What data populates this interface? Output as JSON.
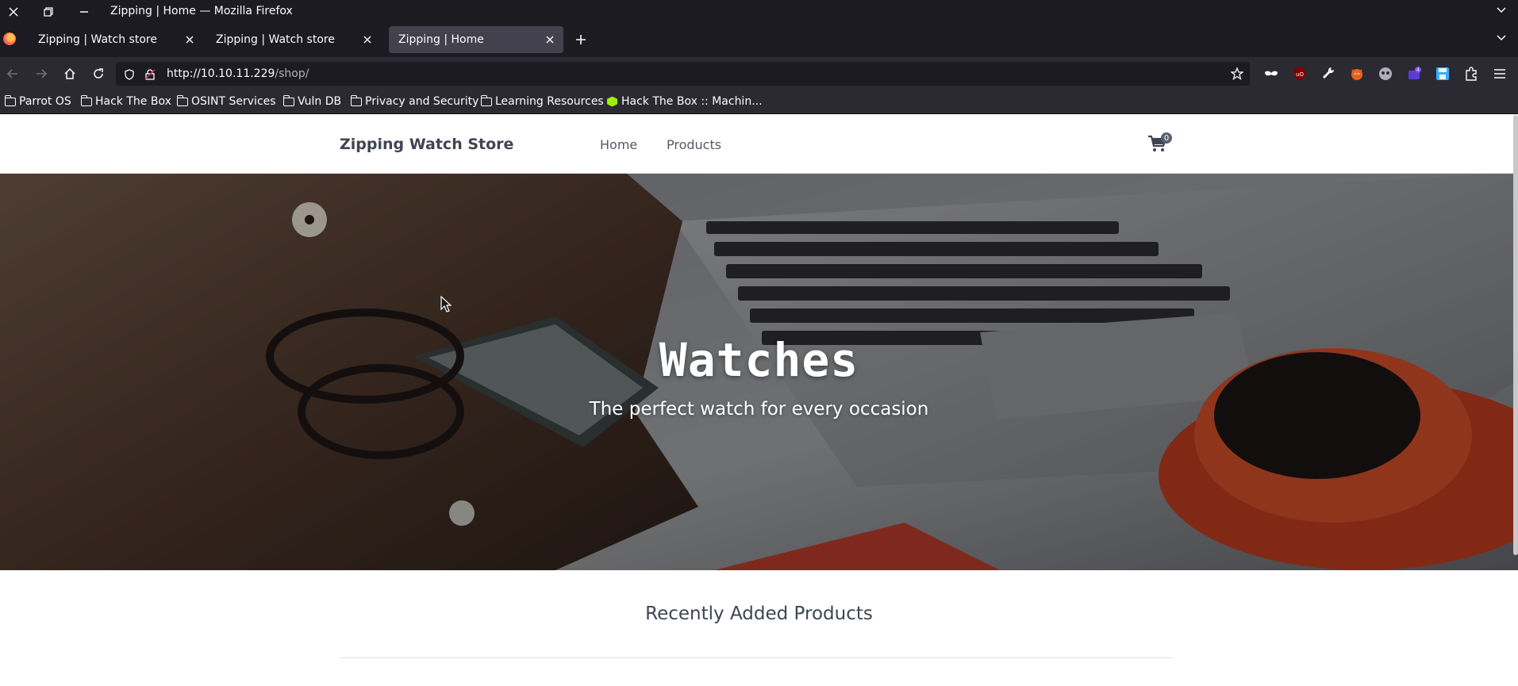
{
  "window": {
    "title": "Zipping | Home — Mozilla Firefox"
  },
  "tabs": [
    {
      "label": "Zipping | Watch store",
      "active": false
    },
    {
      "label": "Zipping | Watch store",
      "active": false
    },
    {
      "label": "Zipping | Home",
      "active": true
    }
  ],
  "navigation": {
    "url_host": "http://10.10.11.229",
    "url_path": "/shop/"
  },
  "bookmarks": [
    {
      "label": "Parrot OS",
      "icon": "folder-icon"
    },
    {
      "label": "Hack The Box",
      "icon": "folder-icon"
    },
    {
      "label": "OSINT Services",
      "icon": "folder-icon"
    },
    {
      "label": "Vuln DB",
      "icon": "folder-icon"
    },
    {
      "label": "Privacy and Security",
      "icon": "folder-icon"
    },
    {
      "label": "Learning Resources",
      "icon": "folder-icon"
    },
    {
      "label": "Hack The Box :: Machin...",
      "icon": "htb-cube-icon"
    }
  ],
  "site": {
    "brand": "Zipping Watch Store",
    "nav": [
      "Home",
      "Products"
    ],
    "cart_count": "0",
    "hero_title": "Watches",
    "hero_subtitle": "The perfect watch for every occasion",
    "section_title": "Recently Added Products"
  },
  "colors": {
    "browser_bg": "#1c1b22",
    "toolbar_bg": "#2b2a33",
    "active_tab": "#42414d",
    "brand_text": "#404452"
  }
}
